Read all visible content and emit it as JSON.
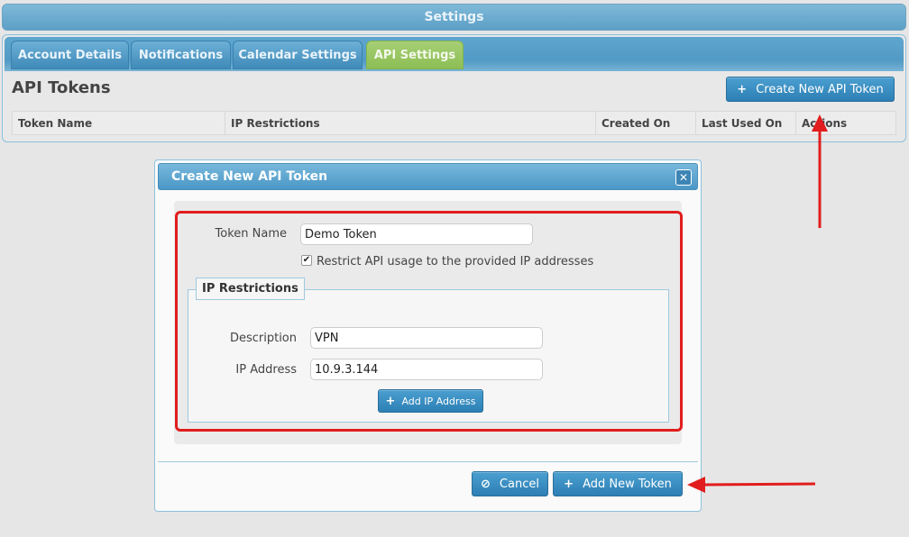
{
  "header": {
    "title": "Settings"
  },
  "tabs": [
    {
      "label": "Account Details",
      "active": false
    },
    {
      "label": "Notifications",
      "active": false
    },
    {
      "label": "Calendar Settings",
      "active": false
    },
    {
      "label": "API Settings",
      "active": true
    }
  ],
  "page": {
    "title": "API Tokens",
    "create_button": {
      "icon": "plus-icon",
      "label": "Create New API Token"
    }
  },
  "table": {
    "columns": [
      "Token Name",
      "IP Restrictions",
      "Created On",
      "Last Used On",
      "Actions"
    ]
  },
  "dialog": {
    "title": "Create New API Token",
    "close_icon": "close-icon",
    "token_name_label": "Token Name",
    "token_name_value": "Demo Token",
    "restrict_checkbox": {
      "checked": true,
      "label": "Restrict API usage to the provided IP addresses"
    },
    "ip_section": {
      "legend": "IP Restrictions",
      "description_label": "Description",
      "description_value": "VPN",
      "ip_label": "IP Address",
      "ip_value": "10.9.3.144",
      "add_ip_button": {
        "icon": "plus-icon",
        "label": "Add IP Address"
      }
    },
    "cancel_button": {
      "icon": "cancel-icon",
      "label": "Cancel"
    },
    "add_token_button": {
      "icon": "plus-icon",
      "label": "Add New Token"
    }
  },
  "colors": {
    "accent_blue": "#2d7fb4",
    "active_tab_green": "#8dbe55",
    "annotation_red": "#e11d1d"
  }
}
